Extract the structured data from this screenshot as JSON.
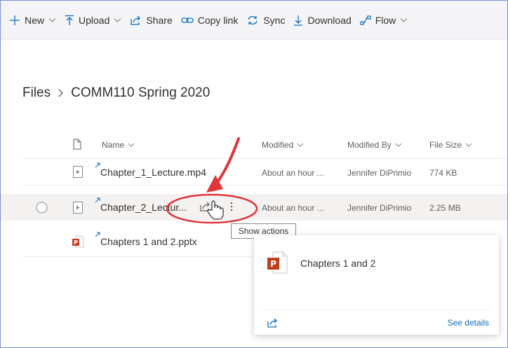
{
  "command_bar": {
    "new": "New",
    "upload": "Upload",
    "share": "Share",
    "copy_link": "Copy link",
    "sync": "Sync",
    "download": "Download",
    "flow": "Flow"
  },
  "breadcrumb": {
    "root": "Files",
    "current": "COMM110 Spring 2020"
  },
  "columns": {
    "name": "Name",
    "modified": "Modified",
    "modified_by": "Modified By",
    "file_size": "File Size"
  },
  "files": [
    {
      "name": "Chapter_1_Lecture.mp4",
      "modified": "About an hour ...",
      "modified_by": "Jennifer DiPrimio",
      "size": "774 KB"
    },
    {
      "name": "Chapter_2_Lectur...",
      "modified": "About an hour ...",
      "modified_by": "Jennifer DiPrimio",
      "size": "2.25 MB"
    },
    {
      "name": "Chapters 1 and 2.pptx"
    }
  ],
  "tooltip": "Show actions",
  "hover_card": {
    "title": "Chapters 1 and 2",
    "see_details": "See details"
  },
  "colors": {
    "accent": "#0f6cbd",
    "annotation_red": "#e0353a",
    "powerpoint": "#c43e1c"
  }
}
